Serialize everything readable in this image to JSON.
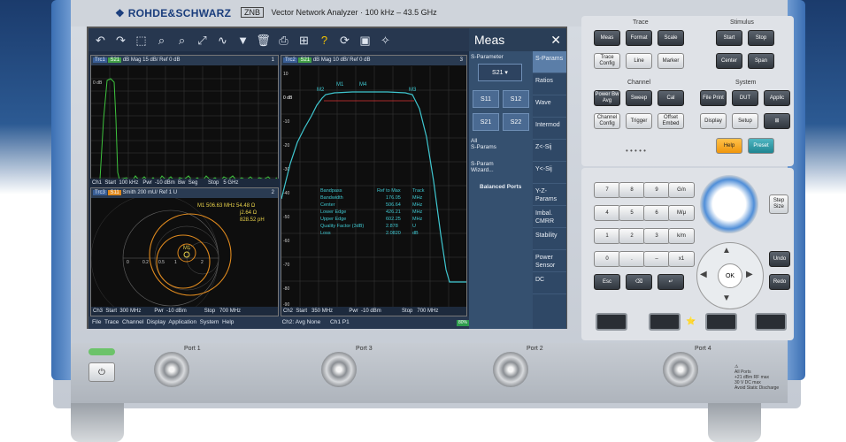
{
  "brand": "ROHDE&SCHWARZ",
  "model_tag": "ZNB",
  "model_desc": "Vector Network Analyzer",
  "freq_range": "100 kHz – 43.5 GHz",
  "meas_panel": {
    "title": "Meas",
    "s_parameter_label": "S-Parameter",
    "s_buttons": [
      "S11",
      "S12",
      "S21",
      "S22"
    ],
    "all_sparams": "All\nS-Params",
    "wizard": "S-Param\nWizard...",
    "balanced": "Balanced Ports",
    "tabs": [
      "S-Params",
      "Ratios",
      "Wave",
      "Intermod",
      "Z<-Sij",
      "Y<-Sij",
      "Y-Z-Params",
      "Imbal. CMRR",
      "Stability",
      "Power Sensor",
      "DC"
    ]
  },
  "diagram1": {
    "trace": "Trc1",
    "param": "S21",
    "scale": "dB Mag  15 dB/ Ref 0 dB",
    "channel": "1",
    "footer": "Ch1  Start  100 kHz   Pwr  -10 dBm  Bw  Seg       Stop   5 GHz"
  },
  "diagram2": {
    "trace": "Trc2",
    "param": "S21",
    "scale": "dB Mag  10 dB/ Ref 0 dB",
    "channel": "3",
    "footer": "Ch2  Start   350 MHz           Pwr  -10 dBm              Stop   700 MHz",
    "markers": [
      "M2",
      "M1",
      "M4",
      "M3"
    ],
    "ref_label": "0 dB",
    "yticks": [
      "10",
      "0",
      "-10",
      "-20",
      "-30",
      "-40",
      "-50",
      "-60",
      "-70",
      "-80",
      "-90"
    ],
    "table": [
      [
        "Bandpass",
        "Ref to Max",
        "Track"
      ],
      [
        "Bandwidth",
        "176.05",
        "MHz"
      ],
      [
        "Center",
        "506.64",
        "MHz"
      ],
      [
        "Lower Edge",
        "426.21",
        "MHz"
      ],
      [
        "Upper Edge",
        "602.25",
        "MHz"
      ],
      [
        "Quality Factor (3dB)",
        "2.878",
        "U"
      ],
      [
        "Loss",
        "2.0820",
        "dB"
      ]
    ]
  },
  "diagram3": {
    "trace": "Trc3",
    "param": "S11",
    "scale": "Smith  200 mU/ Ref 1 U",
    "channel": "2",
    "footer": "Ch3  Start  300 MHz         Pwr  -10 dBm            Stop   700 MHz",
    "marker_line1": "M1  506.63  MHz   54.48  Ω",
    "marker_line2": "j2.64  Ω",
    "marker_line3": "828.52  pH",
    "smith_labels": [
      "0",
      "0.2",
      "0.5",
      "1",
      "2"
    ]
  },
  "statusbar": "File  Trace  Channel  Display  Application  System  Help                              Ch2: Avg None      Ch1 P1",
  "progress_label": "80%",
  "progress_fraction": 0.8,
  "trace_group": {
    "title": "Trace",
    "keys": [
      "Meas",
      "Format",
      "Scale",
      "Trace Config",
      "Line",
      "Marker"
    ]
  },
  "channel_group": {
    "title": "Channel",
    "keys": [
      "Power Bw Avg",
      "Sweep",
      "Cal",
      "Channel Config",
      "Trigger",
      "Offset Embed"
    ]
  },
  "stimulus_group": {
    "title": "Stimulus",
    "keys": [
      "Start",
      "Stop",
      "Center",
      "Span"
    ]
  },
  "system_group": {
    "title": "System",
    "keys": [
      "File Print",
      "DUT",
      "Applic",
      "Display",
      "Setup",
      "⊞",
      "Help",
      "Preset"
    ]
  },
  "numpad": [
    "7",
    "8",
    "9",
    "G/n",
    "4",
    "5",
    "6",
    "M/μ",
    "1",
    "2",
    "3",
    "k/m",
    "0",
    ".",
    "–",
    "x1",
    "Esc",
    "⌫",
    "↵"
  ],
  "nav": {
    "ok": "OK",
    "step_size": "Step Size",
    "undo": "Undo",
    "redo": "Redo"
  },
  "ports": [
    "Port 1",
    "Port 3",
    "Port 2",
    "Port 4"
  ],
  "warning": [
    "All Ports",
    "+21 dBm RF max",
    "30 V DC max",
    "Avoid Static Discharge"
  ]
}
